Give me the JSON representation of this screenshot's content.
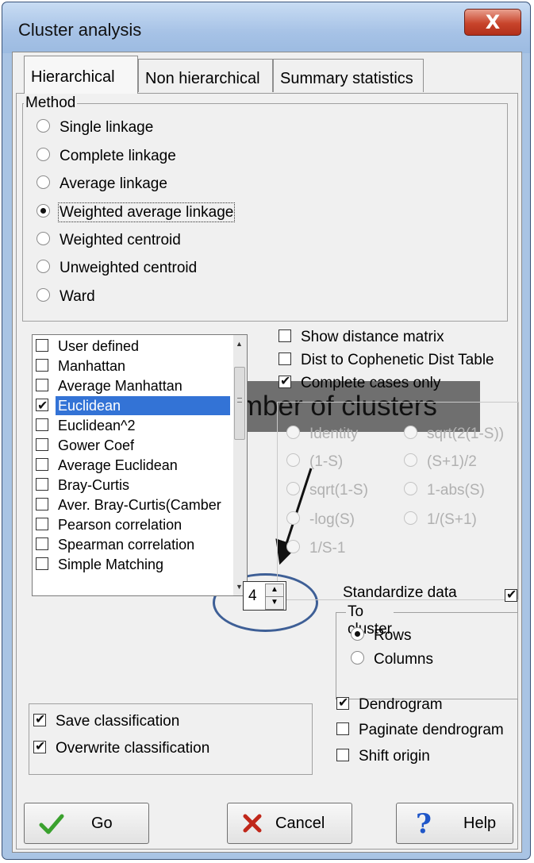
{
  "window": {
    "title": "Cluster analysis",
    "close_glyph": "X"
  },
  "tabs": [
    {
      "label": "Hierarchical",
      "active": true
    },
    {
      "label": "Non hierarchical",
      "active": false
    },
    {
      "label": "Summary statistics",
      "active": false
    }
  ],
  "method": {
    "group_label": "Method",
    "options": [
      {
        "label": "Single linkage",
        "selected": false
      },
      {
        "label": "Complete linkage",
        "selected": false
      },
      {
        "label": "Average linkage",
        "selected": false
      },
      {
        "label": "Weighted average linkage",
        "selected": true
      },
      {
        "label": "Weighted centroid",
        "selected": false
      },
      {
        "label": "Unweighted centroid",
        "selected": false
      },
      {
        "label": "Ward",
        "selected": false
      }
    ]
  },
  "distance_list": [
    {
      "label": "User defined",
      "checked": false
    },
    {
      "label": "Manhattan",
      "checked": false
    },
    {
      "label": "Average Manhattan",
      "checked": false
    },
    {
      "label": "Euclidean",
      "checked": true,
      "selected": true
    },
    {
      "label": "Euclidean^2",
      "checked": false
    },
    {
      "label": "Gower Coef",
      "checked": false
    },
    {
      "label": "Average Euclidean",
      "checked": false
    },
    {
      "label": "Bray-Curtis",
      "checked": false
    },
    {
      "label": "Aver. Bray-Curtis(Camber",
      "checked": false
    },
    {
      "label": "Pearson correlation",
      "checked": false
    },
    {
      "label": "Spearman correlation",
      "checked": false
    },
    {
      "label": "Simple Matching",
      "checked": false
    }
  ],
  "options_right": {
    "show_distance_matrix": {
      "label": "Show distance matrix",
      "checked": false
    },
    "dist_cophenetic": {
      "label": "Dist to Cophenetic Dist Table",
      "checked": false
    },
    "complete_cases": {
      "label": "Complete cases only",
      "checked": true
    }
  },
  "similarity_transform": {
    "options": [
      "Identity",
      "sqrt(2(1-S))",
      "(1-S)",
      "(S+1)/2",
      "sqrt(1-S)",
      "1-abs(S)",
      "-log(S)",
      "1/(S+1)",
      "1/S-1"
    ],
    "disabled": true
  },
  "clusters": {
    "value": "4"
  },
  "standardize": {
    "label": "Standardize data",
    "checked": true
  },
  "to_cluster": {
    "group_label": "To cluster",
    "rows": {
      "label": "Rows",
      "selected": true
    },
    "columns": {
      "label": "Columns",
      "selected": false
    }
  },
  "save": {
    "save_classification": {
      "label": "Save classification",
      "checked": true
    },
    "overwrite_classification": {
      "label": "Overwrite classification",
      "checked": true
    }
  },
  "dendro": {
    "dendrogram": {
      "label": "Dendrogram",
      "checked": true
    },
    "paginate": {
      "label": "Paginate dendrogram",
      "checked": false
    },
    "shift_origin": {
      "label": "Shift origin",
      "checked": false
    }
  },
  "buttons": {
    "go": {
      "label": "Go",
      "icon": "checkmark-icon",
      "color": "#3aa12e"
    },
    "cancel": {
      "label": "Cancel",
      "icon": "x-icon",
      "color": "#c0271a"
    },
    "help": {
      "label": "Help",
      "icon": "question-icon",
      "color": "#1f56c8"
    }
  },
  "annotation": {
    "label": "Number of clusters",
    "circle_color": "#3e5f96"
  }
}
